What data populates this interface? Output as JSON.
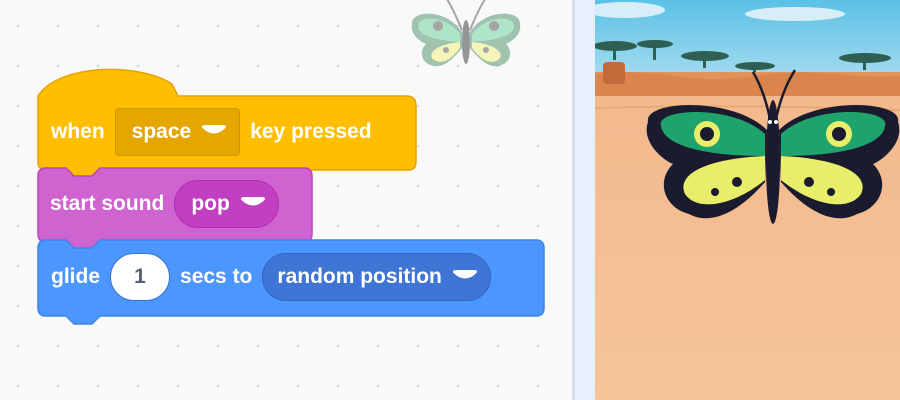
{
  "colors": {
    "events": "#ffbf00",
    "sound": "#cf63cf",
    "motion": "#4c97ff",
    "workspace_bg": "#f9f9f9"
  },
  "scripts": {
    "hat_block": {
      "label_when": "when",
      "key_value": "space",
      "label_key_pressed": "key pressed"
    },
    "sound_block": {
      "label": "start sound",
      "sound_value": "pop"
    },
    "motion_block": {
      "label_glide": "glide",
      "secs_value": "1",
      "label_secs_to": "secs to",
      "target_value": "random position"
    }
  },
  "sprite": {
    "name_icon": "butterfly-icon"
  },
  "stage": {
    "backdrop": "savanna"
  }
}
